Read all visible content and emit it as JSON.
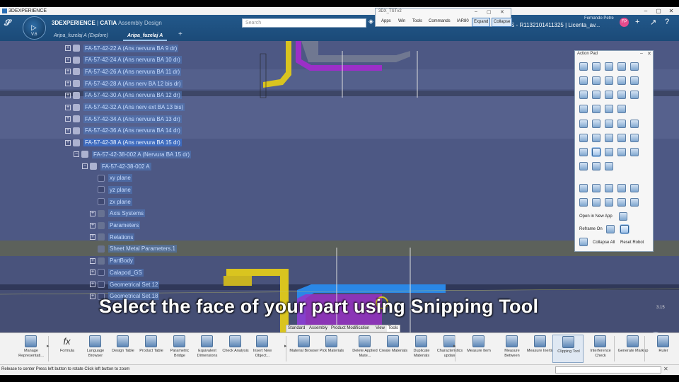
{
  "titlebar": {
    "text": "3DEXPERIENCE"
  },
  "header": {
    "compass_version": "V.6",
    "app_title_brand": "3DEXPERIENCE",
    "app_title_sep": " | ",
    "app_title_product": "CATIA",
    "app_title_app": " Assembly Design",
    "tabs": [
      {
        "label": "Aripa_fuzelaj A (Explore)"
      },
      {
        "label": "Aripa_fuzelaj A"
      }
    ],
    "search_placeholder": "Search",
    "user_name": "Fernando Petre",
    "license_text": "S - R1132101411325 | Licenta_av...",
    "avatar_initials": "FP"
  },
  "floating_window": {
    "title": "3DX_TSTv2",
    "menu": [
      "Apps",
      "Win",
      "Tools",
      "Commands",
      "IAR80",
      "Expand",
      "Collapse"
    ]
  },
  "tree": {
    "rows": [
      {
        "label": "FA-57-42-22 A (Ans nervura BA 9 dr)",
        "exp": "+",
        "kind": "part"
      },
      {
        "label": "FA-57-42-24 A (Ans nervura BA 10 dr)",
        "exp": "+",
        "kind": "part"
      },
      {
        "label": "FA-57-42-26 A (Ans nervura BA 11 dr)",
        "exp": "+",
        "kind": "part"
      },
      {
        "label": "FA-57-42-28 A (Ans nerv  BA 12 bis dr)",
        "exp": "+",
        "kind": "part"
      },
      {
        "label": "FA-57-42-30 A (Ans nervura BA 12 dr)",
        "exp": "+",
        "kind": "part"
      },
      {
        "label": "FA-57-42-32 A (Ans nerv ext BA 13 bis)",
        "exp": "+",
        "kind": "part"
      },
      {
        "label": "FA-57-42-34 A (Ans nervura BA 13 dr)",
        "exp": "+",
        "kind": "part"
      },
      {
        "label": "FA-57-42-36 A (Ans nervura BA 14 dr)",
        "exp": "+",
        "kind": "part"
      },
      {
        "label": "FA-57-42-38 A (Ans nervura BA 15 dr)",
        "exp": "+",
        "kind": "part",
        "selected": true
      },
      {
        "label": "FA-57-42-38-002 A (Nervura BA 15 dr)",
        "exp": "−",
        "kind": "part"
      },
      {
        "label": "FA-57-42-38-002 A",
        "exp": "−",
        "kind": "part"
      },
      {
        "label": "xy plane",
        "exp": "",
        "kind": "plane"
      },
      {
        "label": "yz plane",
        "exp": "",
        "kind": "plane"
      },
      {
        "label": "zx plane",
        "exp": "",
        "kind": "plane"
      },
      {
        "label": "Axis Systems",
        "exp": "+",
        "kind": "geo"
      },
      {
        "label": "Parameters",
        "exp": "+",
        "kind": "geo"
      },
      {
        "label": "Relations",
        "exp": "+",
        "kind": "geo"
      },
      {
        "label": "Sheet Metal Parameters.1",
        "exp": "",
        "kind": "geo"
      },
      {
        "label": "PartBody",
        "exp": "+",
        "kind": "geo"
      },
      {
        "label": "Calapod_GS",
        "exp": "+",
        "kind": "plane"
      },
      {
        "label": "Geometrical Set.12",
        "exp": "+",
        "kind": "plane"
      },
      {
        "label": "Geometrical Set.18",
        "exp": "+",
        "kind": "plane"
      }
    ]
  },
  "caption": "Select the face of your part using Snipping Tool",
  "viewport": {
    "scale_label": "3.15"
  },
  "action_pad": {
    "title": "Action Pad",
    "open_in_new_app": "Open in New App",
    "reframe_on": "Reframe On",
    "collapse_all": "Collapse All",
    "reset_robot": "Reset Robot"
  },
  "toolbar_tabs": [
    "Standard",
    "Assembly",
    "Product Modification",
    "View",
    "Tools"
  ],
  "toolbar_active_tab": "Tools",
  "toolbar": [
    {
      "label": "Manage Representati...",
      "icon": "manage-representations-icon"
    },
    {
      "label": "Formula",
      "icon": "formula-icon"
    },
    {
      "label": "Language Browser",
      "icon": "language-browser-icon"
    },
    {
      "label": "Design Table",
      "icon": "design-table-icon"
    },
    {
      "label": "Product Table",
      "icon": "product-table-icon"
    },
    {
      "label": "Parametric Bridge",
      "icon": "parametric-bridge-icon"
    },
    {
      "label": "Equivalent Dimensions",
      "icon": "equivalent-dimensions-icon"
    },
    {
      "label": "Check Analysis",
      "icon": "check-analysis-icon"
    },
    {
      "label": "Insert New Object...",
      "icon": "insert-new-object-icon"
    },
    {
      "label": "Material Browser",
      "icon": "material-browser-icon"
    },
    {
      "label": "Pick Materials",
      "icon": "pick-materials-icon"
    },
    {
      "label": "Delete Applied Mate...",
      "icon": "delete-applied-materials-icon"
    },
    {
      "label": "Create Materials",
      "icon": "create-materials-icon"
    },
    {
      "label": "Duplicate Materials",
      "icon": "duplicate-materials-icon"
    },
    {
      "label": "Characteristics update",
      "icon": "characteristics-update-icon"
    },
    {
      "label": "Measure Item",
      "icon": "measure-item-icon"
    },
    {
      "label": "Measure Between",
      "icon": "measure-between-icon"
    },
    {
      "label": "Measure Inertia",
      "icon": "measure-inertia-icon"
    },
    {
      "label": "Clipping Tool",
      "icon": "clipping-tool-icon",
      "selected": true
    },
    {
      "label": "Interference Check",
      "icon": "interference-check-icon"
    },
    {
      "label": "Generate Markup",
      "icon": "generate-markup-icon"
    },
    {
      "label": "Ruler",
      "icon": "ruler-icon"
    }
  ],
  "status": {
    "text": "Release to center  Press left button to rotate  Click left button to zoom"
  }
}
